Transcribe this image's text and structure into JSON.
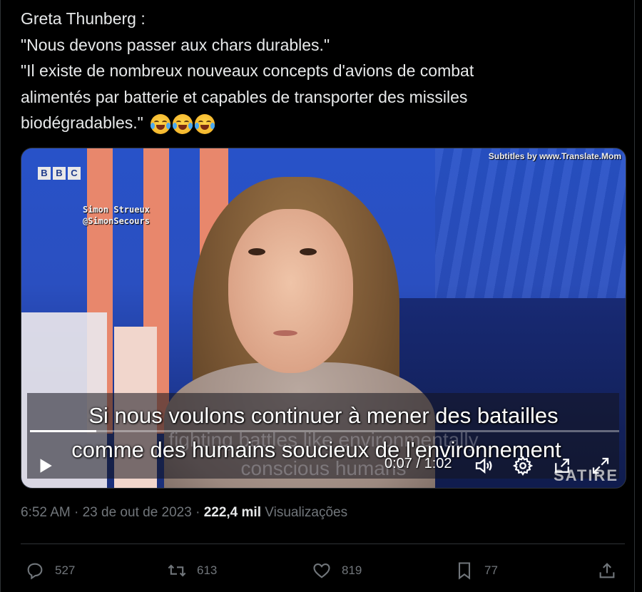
{
  "tweet": {
    "lines": [
      "Greta Thunberg :",
      "\"Nous devons passer aux chars durables.\"",
      "\"Il existe de nombreux nouveaux concepts d'avions de combat",
      "alimentés par batterie et capables de transporter des missiles",
      "biodégradables.\""
    ],
    "emoji": [
      "face-with-tears-of-joy",
      "face-with-tears-of-joy",
      "face-with-tears-of-joy"
    ]
  },
  "video": {
    "channel_logo": [
      "B",
      "B",
      "C"
    ],
    "watermark_line1": "Simon Strueux",
    "watermark_line2": "@SimonSecours",
    "subtitles_credit": "Subtitles by www.Translate.Mom",
    "caption_line1": "Si nous voulons continuer à mener des batailles",
    "caption_line2": "comme des humains soucieux de l'environnement",
    "ghost_line1": "fighting battles like environmentally",
    "ghost_line2": "conscious humans",
    "satire_label": "SATIRE",
    "time": "0:07 / 1:02",
    "progress_fraction": 0.113,
    "icons": [
      "play-icon",
      "volume-icon",
      "settings-icon",
      "pip-icon",
      "fullscreen-icon"
    ]
  },
  "meta": {
    "time": "6:52 AM",
    "date": "23 de out de 2023",
    "views_count": "222,4 mil",
    "views_label": "Visualizações"
  },
  "actions": {
    "reply_count": "527",
    "retweet_count": "613",
    "like_count": "819",
    "bookmark_count": "77"
  }
}
